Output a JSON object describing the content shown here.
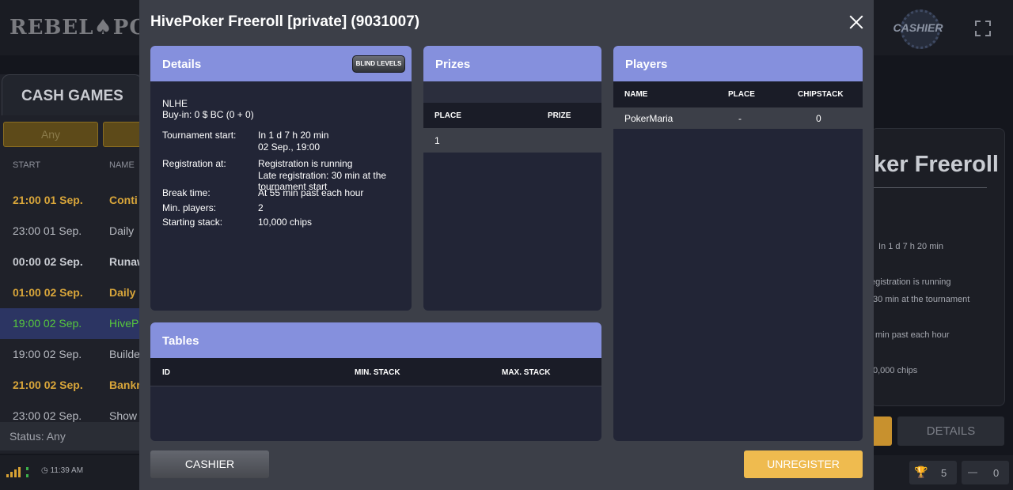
{
  "background": {
    "logo": "REBEL♠POKER",
    "cashier_label": "CASHIER",
    "lobby": {
      "tab_label": "CASH GAMES",
      "filter_label": "Any",
      "columns": [
        "START",
        "NAME"
      ],
      "rows": [
        {
          "start": "21:00 01 Sep.",
          "name": "Conti",
          "color": "#d9a63a",
          "bold": true
        },
        {
          "start": "23:00 01 Sep.",
          "name": "Daily",
          "color": "#b8bbc2",
          "bold": false
        },
        {
          "start": "00:00 02 Sep.",
          "name": "Runaw",
          "color": "#c9ccd2",
          "bold": true
        },
        {
          "start": "01:00 02 Sep.",
          "name": "Daily",
          "color": "#d9a63a",
          "bold": true
        },
        {
          "start": "19:00 02 Sep.",
          "name": "HiveP",
          "color": "#57c83c",
          "bold": false,
          "selected": true
        },
        {
          "start": "19:00 02 Sep.",
          "name": "Builde",
          "color": "#b8bbc2",
          "bold": false
        },
        {
          "start": "21:00 02 Sep.",
          "name": "Bankr",
          "color": "#d9a63a",
          "bold": true
        },
        {
          "start": "23:00 02 Sep.",
          "name": "Show",
          "color": "#b8bbc2",
          "bold": false
        }
      ],
      "status": "Status: Any",
      "clock": "11:39 AM"
    },
    "right_panel": {
      "title": "ker Freeroll",
      "start": "In 1 d 7 h 20 min",
      "reg1": "egistration is running",
      "reg2": "30 min at the tournament",
      "break": "min past each hour",
      "stack": "0,000 chips",
      "details_button": "DETAILS",
      "count_a": "5",
      "count_b": "0"
    }
  },
  "modal": {
    "title": "HivePoker Freeroll [private] (9031007)",
    "details": {
      "header": "Details",
      "blind_levels_button": "BLIND LEVELS",
      "game": "NLHE",
      "buyin": "Buy-in: 0 $ BC (0 + 0)",
      "rows": [
        {
          "label": "Tournament start:",
          "lines": [
            "In 1 d 7 h 20 min",
            "02 Sep., 19:00"
          ]
        },
        {
          "label": "Registration at:",
          "lines": [
            "Registration is running",
            "Late registration: 30 min at the",
            "tournament start"
          ]
        },
        {
          "label": "Break time:",
          "lines": [
            "At 55 min past each hour"
          ]
        },
        {
          "label": "Min. players:",
          "lines": [
            "2"
          ]
        },
        {
          "label": "Starting stack:",
          "lines": [
            "10,000 chips"
          ]
        }
      ]
    },
    "prizes": {
      "header": "Prizes",
      "columns": [
        "PLACE",
        "PRIZE"
      ],
      "rows": [
        {
          "place": "1",
          "prize": ""
        }
      ]
    },
    "players": {
      "header": "Players",
      "columns": [
        "NAME",
        "PLACE",
        "CHIPSTACK"
      ],
      "rows": [
        {
          "name": "PokerMaria",
          "place": "-",
          "chipstack": "0"
        }
      ]
    },
    "tables": {
      "header": "Tables",
      "columns": [
        "ID",
        "MIN. STACK",
        "MAX. STACK"
      ],
      "rows": []
    },
    "cashier_button": "CASHIER",
    "unregister_button": "UNREGISTER"
  },
  "colors": {
    "panel_header": "#8590dd",
    "unregister": "#efbb4f",
    "modal_bg": "#3c3f48",
    "panel_bg": "#222536"
  }
}
